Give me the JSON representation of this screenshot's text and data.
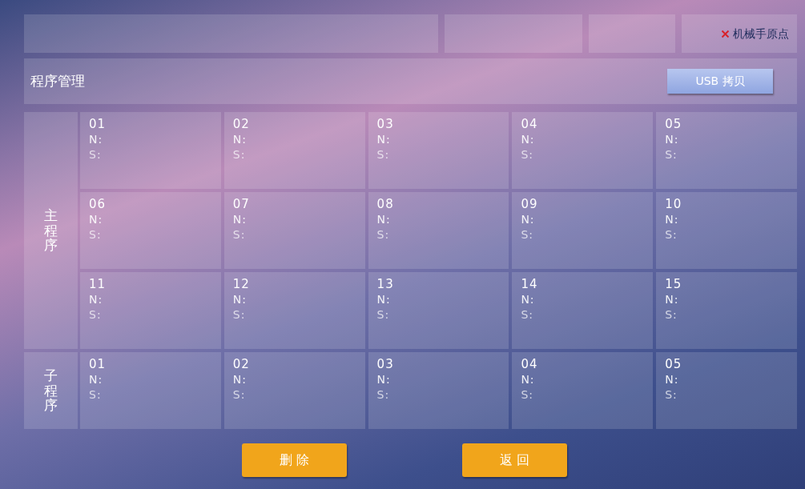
{
  "status_bar": {
    "home_status": {
      "label": "机械手原点",
      "ok": false
    }
  },
  "header": {
    "title": "程序管理",
    "button": "USB 拷贝"
  },
  "groups": [
    {
      "label": "主程序",
      "rows": [
        [
          {
            "number": "01",
            "n": "N:",
            "s": "S:"
          },
          {
            "number": "02",
            "n": "N:",
            "s": "S:"
          },
          {
            "number": "03",
            "n": "N:",
            "s": "S:"
          },
          {
            "number": "04",
            "n": "N:",
            "s": "S:"
          },
          {
            "number": "05",
            "n": "N:",
            "s": "S:"
          }
        ],
        [
          {
            "number": "06",
            "n": "N:",
            "s": "S:"
          },
          {
            "number": "07",
            "n": "N:",
            "s": "S:"
          },
          {
            "number": "08",
            "n": "N:",
            "s": "S:"
          },
          {
            "number": "09",
            "n": "N:",
            "s": "S:"
          },
          {
            "number": "10",
            "n": "N:",
            "s": "S:"
          }
        ],
        [
          {
            "number": "11",
            "n": "N:",
            "s": "S:"
          },
          {
            "number": "12",
            "n": "N:",
            "s": "S:"
          },
          {
            "number": "13",
            "n": "N:",
            "s": "S:"
          },
          {
            "number": "14",
            "n": "N:",
            "s": "S:"
          },
          {
            "number": "15",
            "n": "N:",
            "s": "S:"
          }
        ]
      ]
    },
    {
      "label": "子程序",
      "rows": [
        [
          {
            "number": "01",
            "n": "N:",
            "s": "S:"
          },
          {
            "number": "02",
            "n": "N:",
            "s": "S:"
          },
          {
            "number": "03",
            "n": "N:",
            "s": "S:"
          },
          {
            "number": "04",
            "n": "N:",
            "s": "S:"
          },
          {
            "number": "05",
            "n": "N:",
            "s": "S:"
          }
        ]
      ]
    }
  ],
  "buttons": [
    "删 除",
    "返 回"
  ]
}
